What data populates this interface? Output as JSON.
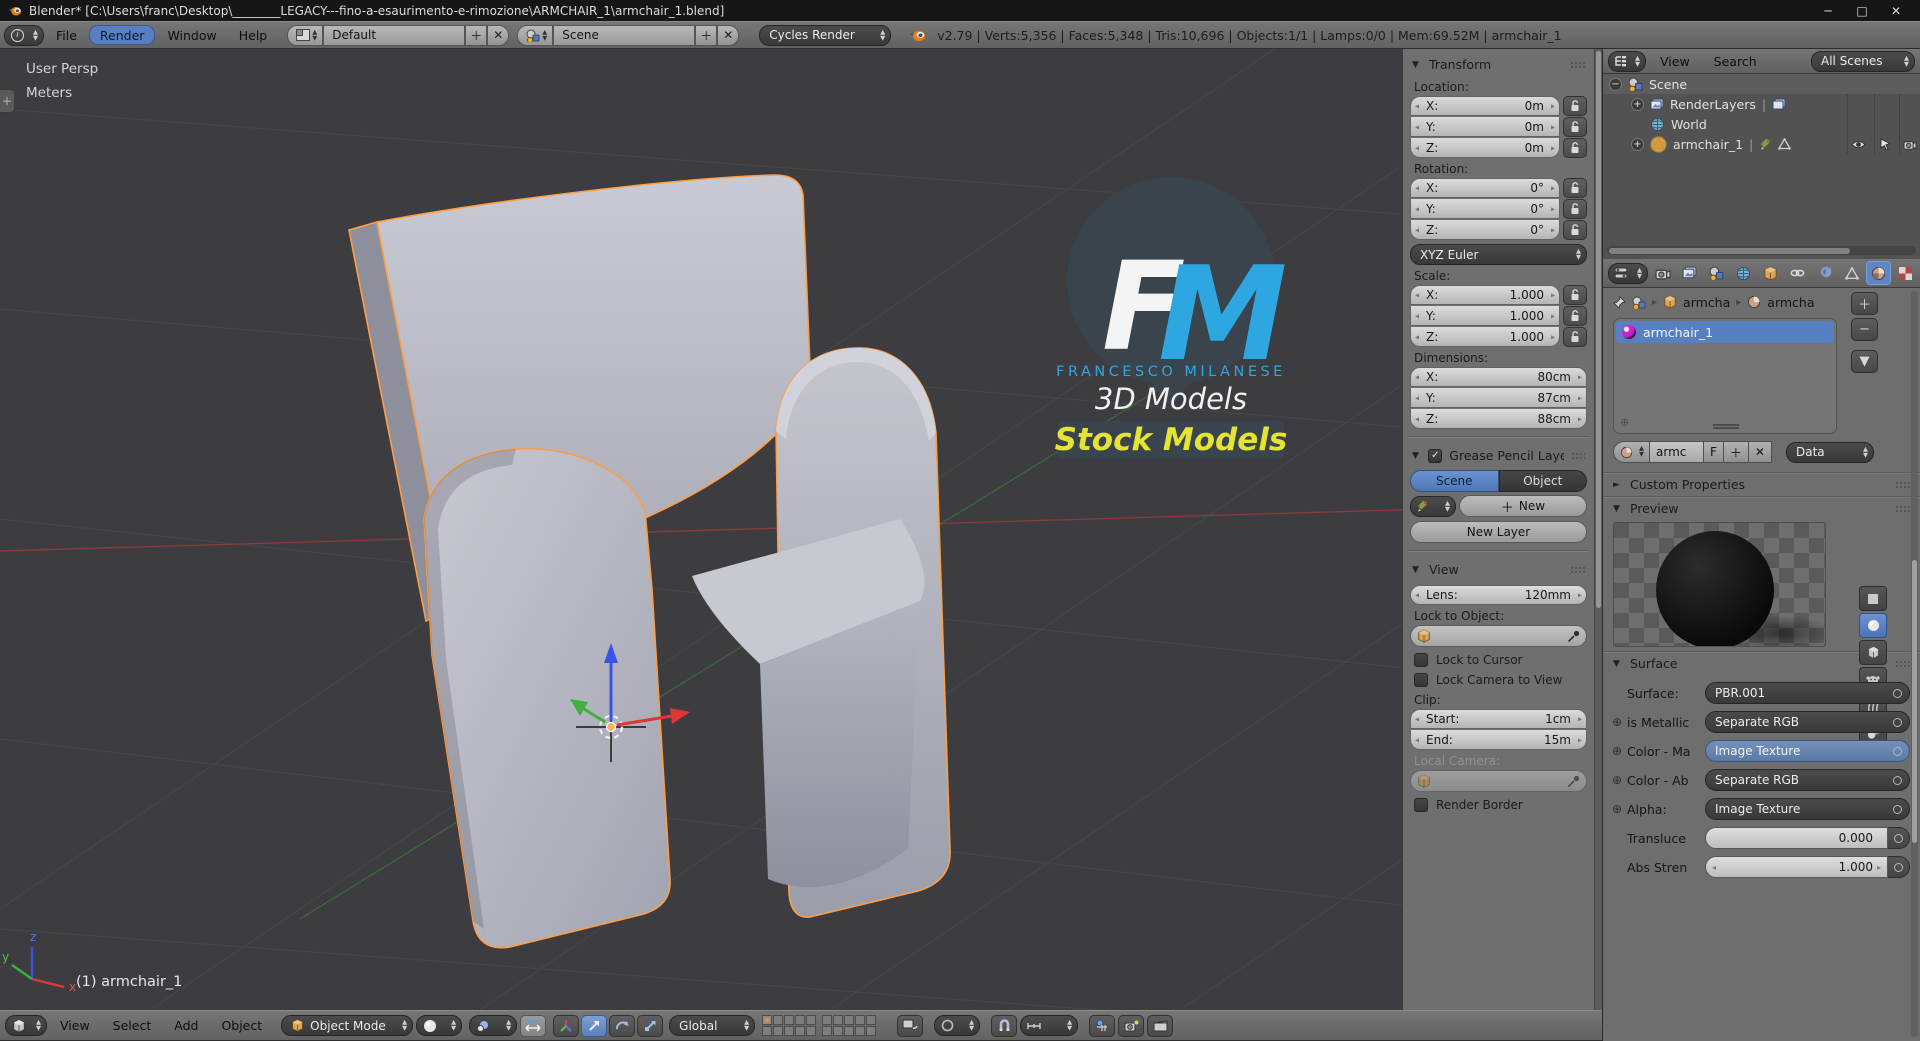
{
  "colors": {
    "accent_blue": "#5680c2",
    "select_orange": "#ff9d45",
    "viewport_bg": "#3d3d41",
    "logo_blue": "#2ea7e0",
    "banner_yellow": "#e5e333"
  },
  "title_bar": {
    "title": "Blender* [C:\\Users\\franc\\Desktop\\________LEGACY---fino-a-esaurimento-e-rimozione\\ARMCHAIR_1\\armchair_1.blend]",
    "minimize": "─",
    "maximize": "□",
    "close": "✕"
  },
  "top_header": {
    "menu_file": "File",
    "menu_render": "Render",
    "menu_window": "Window",
    "menu_help": "Help",
    "layout_name": "Default",
    "scene_name": "Scene",
    "engine": "Cycles Render",
    "stats": "v2.79 | Verts:5,356 | Faces:5,348 | Tris:10,696 | Objects:1/1 | Lamps:0/0 | Mem:69.52M | armchair_1"
  },
  "viewport": {
    "view_label": "User Persp",
    "unit_label": "Meters",
    "object_label": "(1) armchair_1",
    "axis_x": "x",
    "axis_y": "y",
    "axis_z": "z",
    "watermark": {
      "f": "F",
      "m": "M",
      "name": "FRANCESCO MILANESE",
      "sub": "3D Models",
      "banner": "Stock Models"
    }
  },
  "n_panel": {
    "transform": {
      "title": "Transform",
      "location_label": "Location:",
      "loc_x_label": "X:",
      "loc_x": "0m",
      "loc_y_label": "Y:",
      "loc_y": "0m",
      "loc_z_label": "Z:",
      "loc_z": "0m",
      "rotation_label": "Rotation:",
      "rot_x_label": "X:",
      "rot_x": "0°",
      "rot_y_label": "Y:",
      "rot_y": "0°",
      "rot_z_label": "Z:",
      "rot_z": "0°",
      "euler": "XYZ Euler",
      "scale_label": "Scale:",
      "scl_x_label": "X:",
      "scl_x": "1.000",
      "scl_y_label": "Y:",
      "scl_y": "1.000",
      "scl_z_label": "Z:",
      "scl_z": "1.000",
      "dimensions_label": "Dimensions:",
      "dim_x_label": "X:",
      "dim_x": "80cm",
      "dim_y_label": "Y:",
      "dim_y": "87cm",
      "dim_z_label": "Z:",
      "dim_z": "88cm"
    },
    "grease": {
      "title": "Grease Pencil Layer",
      "tab_scene": "Scene",
      "tab_object": "Object",
      "new_btn": "New",
      "new_layer_btn": "New Layer"
    },
    "view": {
      "title": "View",
      "lens_label": "Lens:",
      "lens": "120mm",
      "lock_obj_label": "Lock to Object:",
      "lock_cursor": "Lock to Cursor",
      "lock_camera": "Lock Camera to View",
      "clip_label": "Clip:",
      "start_label": "Start:",
      "start": "1cm",
      "end_label": "End:",
      "end": "15m",
      "local_cam_label": "Local Camera:",
      "render_border": "Render Border"
    }
  },
  "outliner": {
    "menu_view": "View",
    "menu_search": "Search",
    "filter": "All Scenes",
    "scene": "Scene",
    "renderlayers": "RenderLayers",
    "world": "World",
    "object": "armchair_1"
  },
  "properties": {
    "breadcrumb_obj": "armcha",
    "breadcrumb_mat": "armcha",
    "slot_name": "armchair_1",
    "mat_name": "armc",
    "fake_user": "F",
    "link_label": "Data",
    "custom_props_title": "Custom Properties",
    "preview_title": "Preview",
    "surface_title": "Surface",
    "surface_label": "Surface:",
    "surface_value": "PBR.001",
    "row1_label": "is Metallic",
    "row1_value": "Separate RGB",
    "row2_label": "Color - Ma",
    "row2_value": "Image Texture",
    "row3_label": "Color - Ab",
    "row3_value": "Separate RGB",
    "row4_label": "Alpha:",
    "row4_value": "Image Texture",
    "row5_label": "Transluce",
    "row5_value": "0.000",
    "row6_label": "Abs Stren",
    "row6_value": "1.000"
  },
  "bottom_header": {
    "menu_view": "View",
    "menu_select": "Select",
    "menu_add": "Add",
    "menu_object": "Object",
    "mode": "Object Mode",
    "orientation": "Global"
  }
}
